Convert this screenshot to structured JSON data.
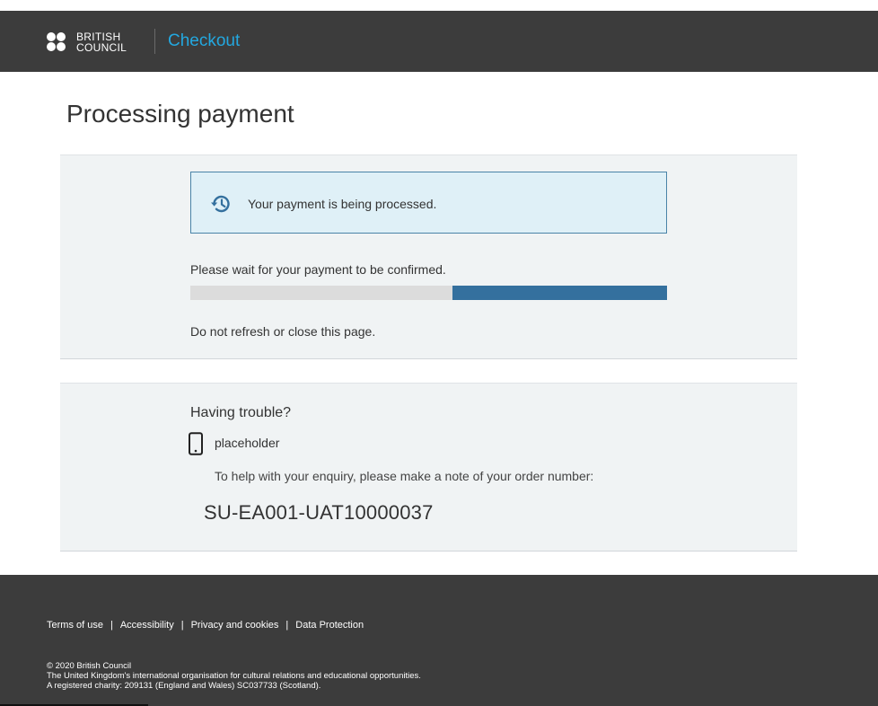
{
  "header": {
    "logo_line1": "BRITISH",
    "logo_line2": "COUNCIL",
    "title": "Checkout"
  },
  "page": {
    "title": "Processing payment"
  },
  "processing": {
    "status_message": "Your payment is being processed.",
    "status_icon": "history-icon",
    "wait_message": "Please wait for your payment to be confirmed.",
    "progress_fraction": 0.45,
    "refresh_warning": "Do not refresh or close this page."
  },
  "help": {
    "heading": "Having trouble?",
    "phone_icon": "mobile-phone-icon",
    "phone_text": "placeholder",
    "enquiry_text": "To help with your enquiry, please make a note of your order number:",
    "order_number": "SU-EA001-UAT10000037"
  },
  "footer": {
    "links": [
      {
        "label": "Terms of use"
      },
      {
        "label": "Accessibility"
      },
      {
        "label": "Privacy and cookies"
      },
      {
        "label": "Data Protection"
      }
    ],
    "separator": "|",
    "copyright": "© 2020 British Council",
    "description": "The United Kingdom's international organisation for cultural relations and educational opportunities.",
    "charity": "A registered charity: 209131 (England and Wales) SC037733 (Scotland)."
  },
  "colors": {
    "header_bg": "#3c3c3c",
    "accent": "#23a8e0",
    "progress_fill": "#34709e",
    "status_box_bg": "#dff0f7",
    "panel_bg": "#f0f3f4"
  }
}
